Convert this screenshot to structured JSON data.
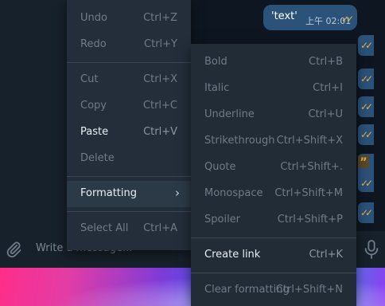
{
  "chat": {
    "bubble_text": "'text'",
    "bubble_time": "上午 02:01",
    "quote_glyph": "”"
  },
  "composer": {
    "placeholder": "Write a message..."
  },
  "context_menu": {
    "items": [
      {
        "label": "Undo",
        "shortcut": "Ctrl+Z"
      },
      {
        "label": "Redo",
        "shortcut": "Ctrl+Y"
      },
      {
        "label": "Cut",
        "shortcut": "Ctrl+X"
      },
      {
        "label": "Copy",
        "shortcut": "Ctrl+C"
      },
      {
        "label": "Paste",
        "shortcut": "Ctrl+V"
      },
      {
        "label": "Delete",
        "shortcut": ""
      },
      {
        "label": "Formatting",
        "shortcut": ""
      },
      {
        "label": "Select All",
        "shortcut": "Ctrl+A"
      }
    ]
  },
  "formatting_menu": {
    "items": [
      {
        "label": "Bold",
        "shortcut": "Ctrl+B"
      },
      {
        "label": "Italic",
        "shortcut": "Ctrl+I"
      },
      {
        "label": "Underline",
        "shortcut": "Ctrl+U"
      },
      {
        "label": "Strikethrough",
        "shortcut": "Ctrl+Shift+X"
      },
      {
        "label": "Quote",
        "shortcut": "Ctrl+Shift+."
      },
      {
        "label": "Monospace",
        "shortcut": "Ctrl+Shift+M"
      },
      {
        "label": "Spoiler",
        "shortcut": "Ctrl+Shift+P"
      },
      {
        "label": "Create link",
        "shortcut": "Ctrl+K"
      },
      {
        "label": "Clear formatting",
        "shortcut": "Ctrl+Shift+N"
      }
    ]
  },
  "icons": {
    "attach": "paperclip-icon",
    "mic": "microphone-icon",
    "read": "double-check-icon",
    "submenu": "chevron-right-icon"
  },
  "colors": {
    "menu_bg": "#232e3a",
    "enabled_text": "#e9eef3",
    "disabled_text": "#6f7b86",
    "check_color": "#e6b24a",
    "bubble_bg": "#2b5278"
  }
}
